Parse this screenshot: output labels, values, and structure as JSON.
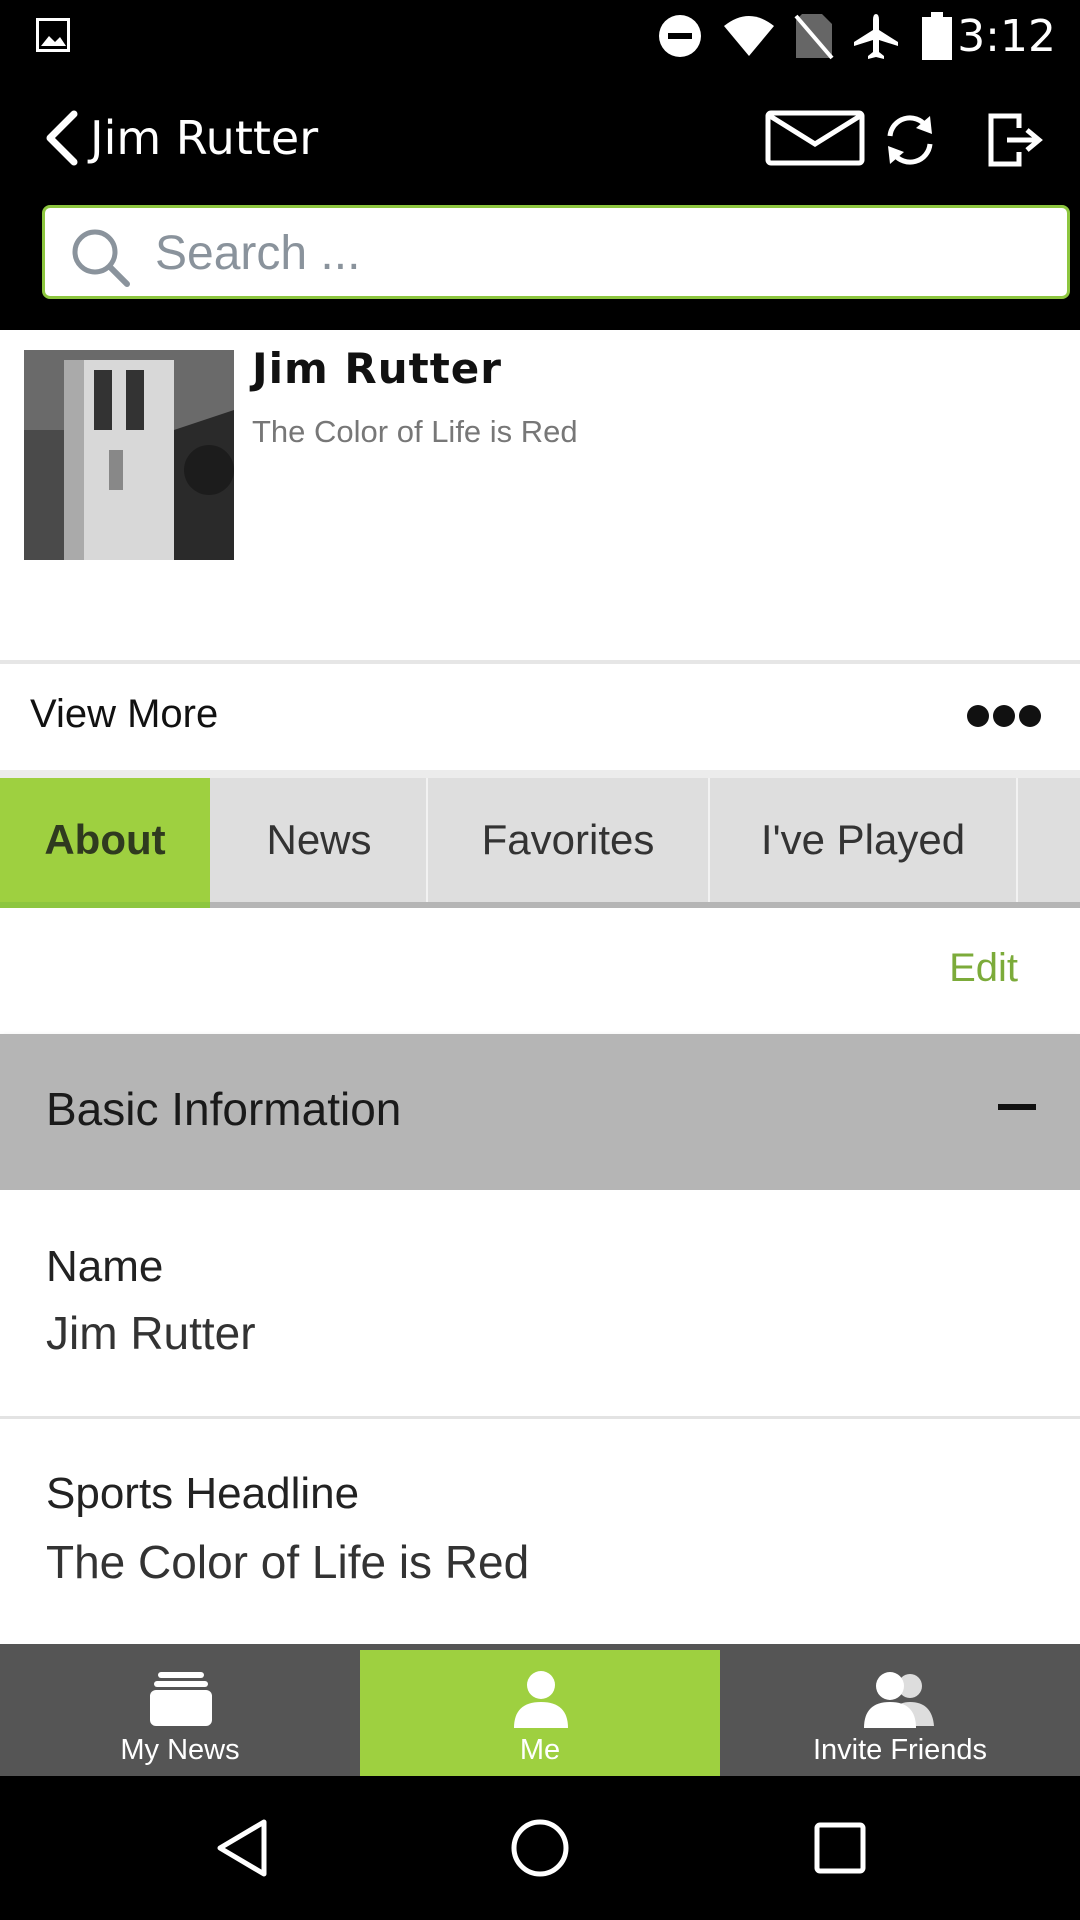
{
  "status_bar": {
    "time": "3:12"
  },
  "header": {
    "title": "Jim Rutter"
  },
  "search": {
    "placeholder": "Search ..."
  },
  "profile": {
    "name": "Jim Rutter",
    "tagline": "The Color of Life is Red"
  },
  "view_more": {
    "label": "View More"
  },
  "tabs": [
    {
      "label": "About"
    },
    {
      "label": "News"
    },
    {
      "label": "Favorites"
    },
    {
      "label": "I've Played"
    }
  ],
  "edit": {
    "label": "Edit"
  },
  "section": {
    "title": "Basic Information"
  },
  "fields": [
    {
      "label": "Name",
      "value": "Jim Rutter"
    },
    {
      "label": "Sports Headline",
      "value": "The Color of Life is Red"
    }
  ],
  "bottom_nav": [
    {
      "label": "My News",
      "icon": "news-stack-icon"
    },
    {
      "label": "Me",
      "icon": "person-icon"
    },
    {
      "label": "Invite Friends",
      "icon": "friends-icon"
    }
  ],
  "colors": {
    "accent": "#9ed040",
    "edit_link": "#7cab3a",
    "section_bg": "#b5b5b5",
    "nav_bg": "#555555"
  }
}
